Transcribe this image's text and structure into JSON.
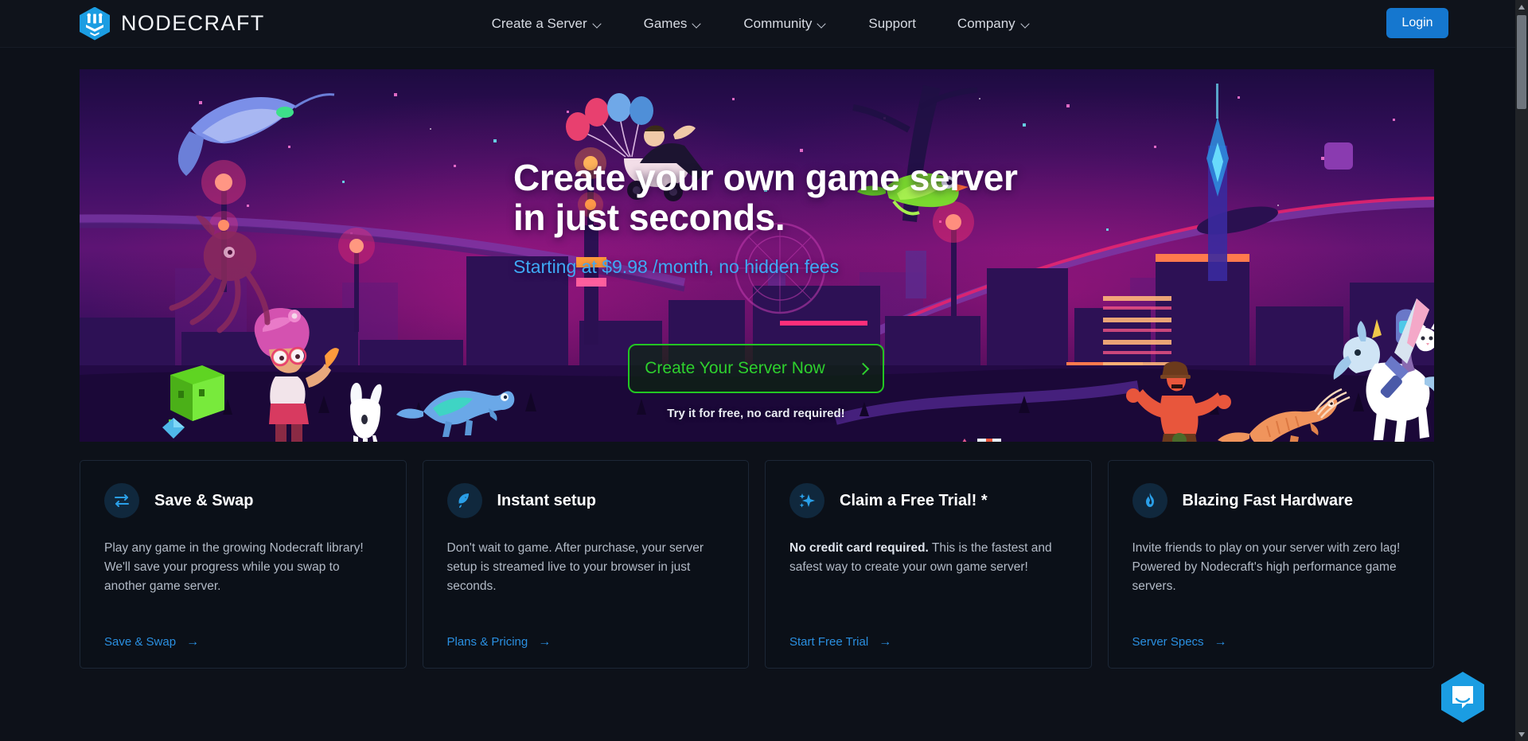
{
  "brand": {
    "name": "NODECRAFT",
    "logo_icon": "nodecraft-hex-logo-icon",
    "logo_color": "#1b9de2"
  },
  "nav": {
    "items": [
      {
        "label": "Create a Server",
        "has_dropdown": true
      },
      {
        "label": "Games",
        "has_dropdown": true
      },
      {
        "label": "Community",
        "has_dropdown": true
      },
      {
        "label": "Support",
        "has_dropdown": false
      },
      {
        "label": "Company",
        "has_dropdown": true
      }
    ],
    "login_label": "Login",
    "login_color": "#1577cf"
  },
  "hero": {
    "title_line1": "Create your own game server",
    "title_line2": "in just seconds.",
    "subtitle": "Starting at $9.98 /month, no hidden fees",
    "subtitle_color": "#3fa9f5",
    "cta_label": "Create Your Server Now",
    "cta_icon": "chevron-right-icon",
    "cta_color": "#2ed02e",
    "cta_note": "Try it for free, no card required!"
  },
  "cards": [
    {
      "icon": "swap-arrows-icon",
      "title": "Save & Swap",
      "body_lead": "",
      "body": "Play any game in the growing Nodecraft library! We'll save your progress while you swap to another game server.",
      "link_label": "Save & Swap",
      "link_icon": "arrow-right-icon"
    },
    {
      "icon": "rocket-icon",
      "title": "Instant setup",
      "body_lead": "",
      "body": "Don't wait to game. After purchase, your server setup is streamed live to your browser in just seconds.",
      "link_label": "Plans & Pricing",
      "link_icon": "arrow-right-icon"
    },
    {
      "icon": "sparkles-icon",
      "title": "Claim a Free Trial! *",
      "body_lead": "No credit card required.",
      "body": " This is the fastest and safest way to create your own game server!",
      "link_label": "Start Free Trial",
      "link_icon": "arrow-right-icon"
    },
    {
      "icon": "flame-icon",
      "title": "Blazing Fast Hardware",
      "body_lead": "",
      "body": "Invite friends to play on your server with zero lag! Powered by Nodecraft's high performance game servers.",
      "link_label": "Server Specs",
      "link_icon": "arrow-right-icon"
    }
  ],
  "chat": {
    "icon": "intercom-chat-bubble-icon",
    "color": "#1b9de2"
  },
  "scrollbar": {
    "up_icon": "scroll-up-arrow-icon",
    "down_icon": "scroll-down-arrow-icon"
  }
}
